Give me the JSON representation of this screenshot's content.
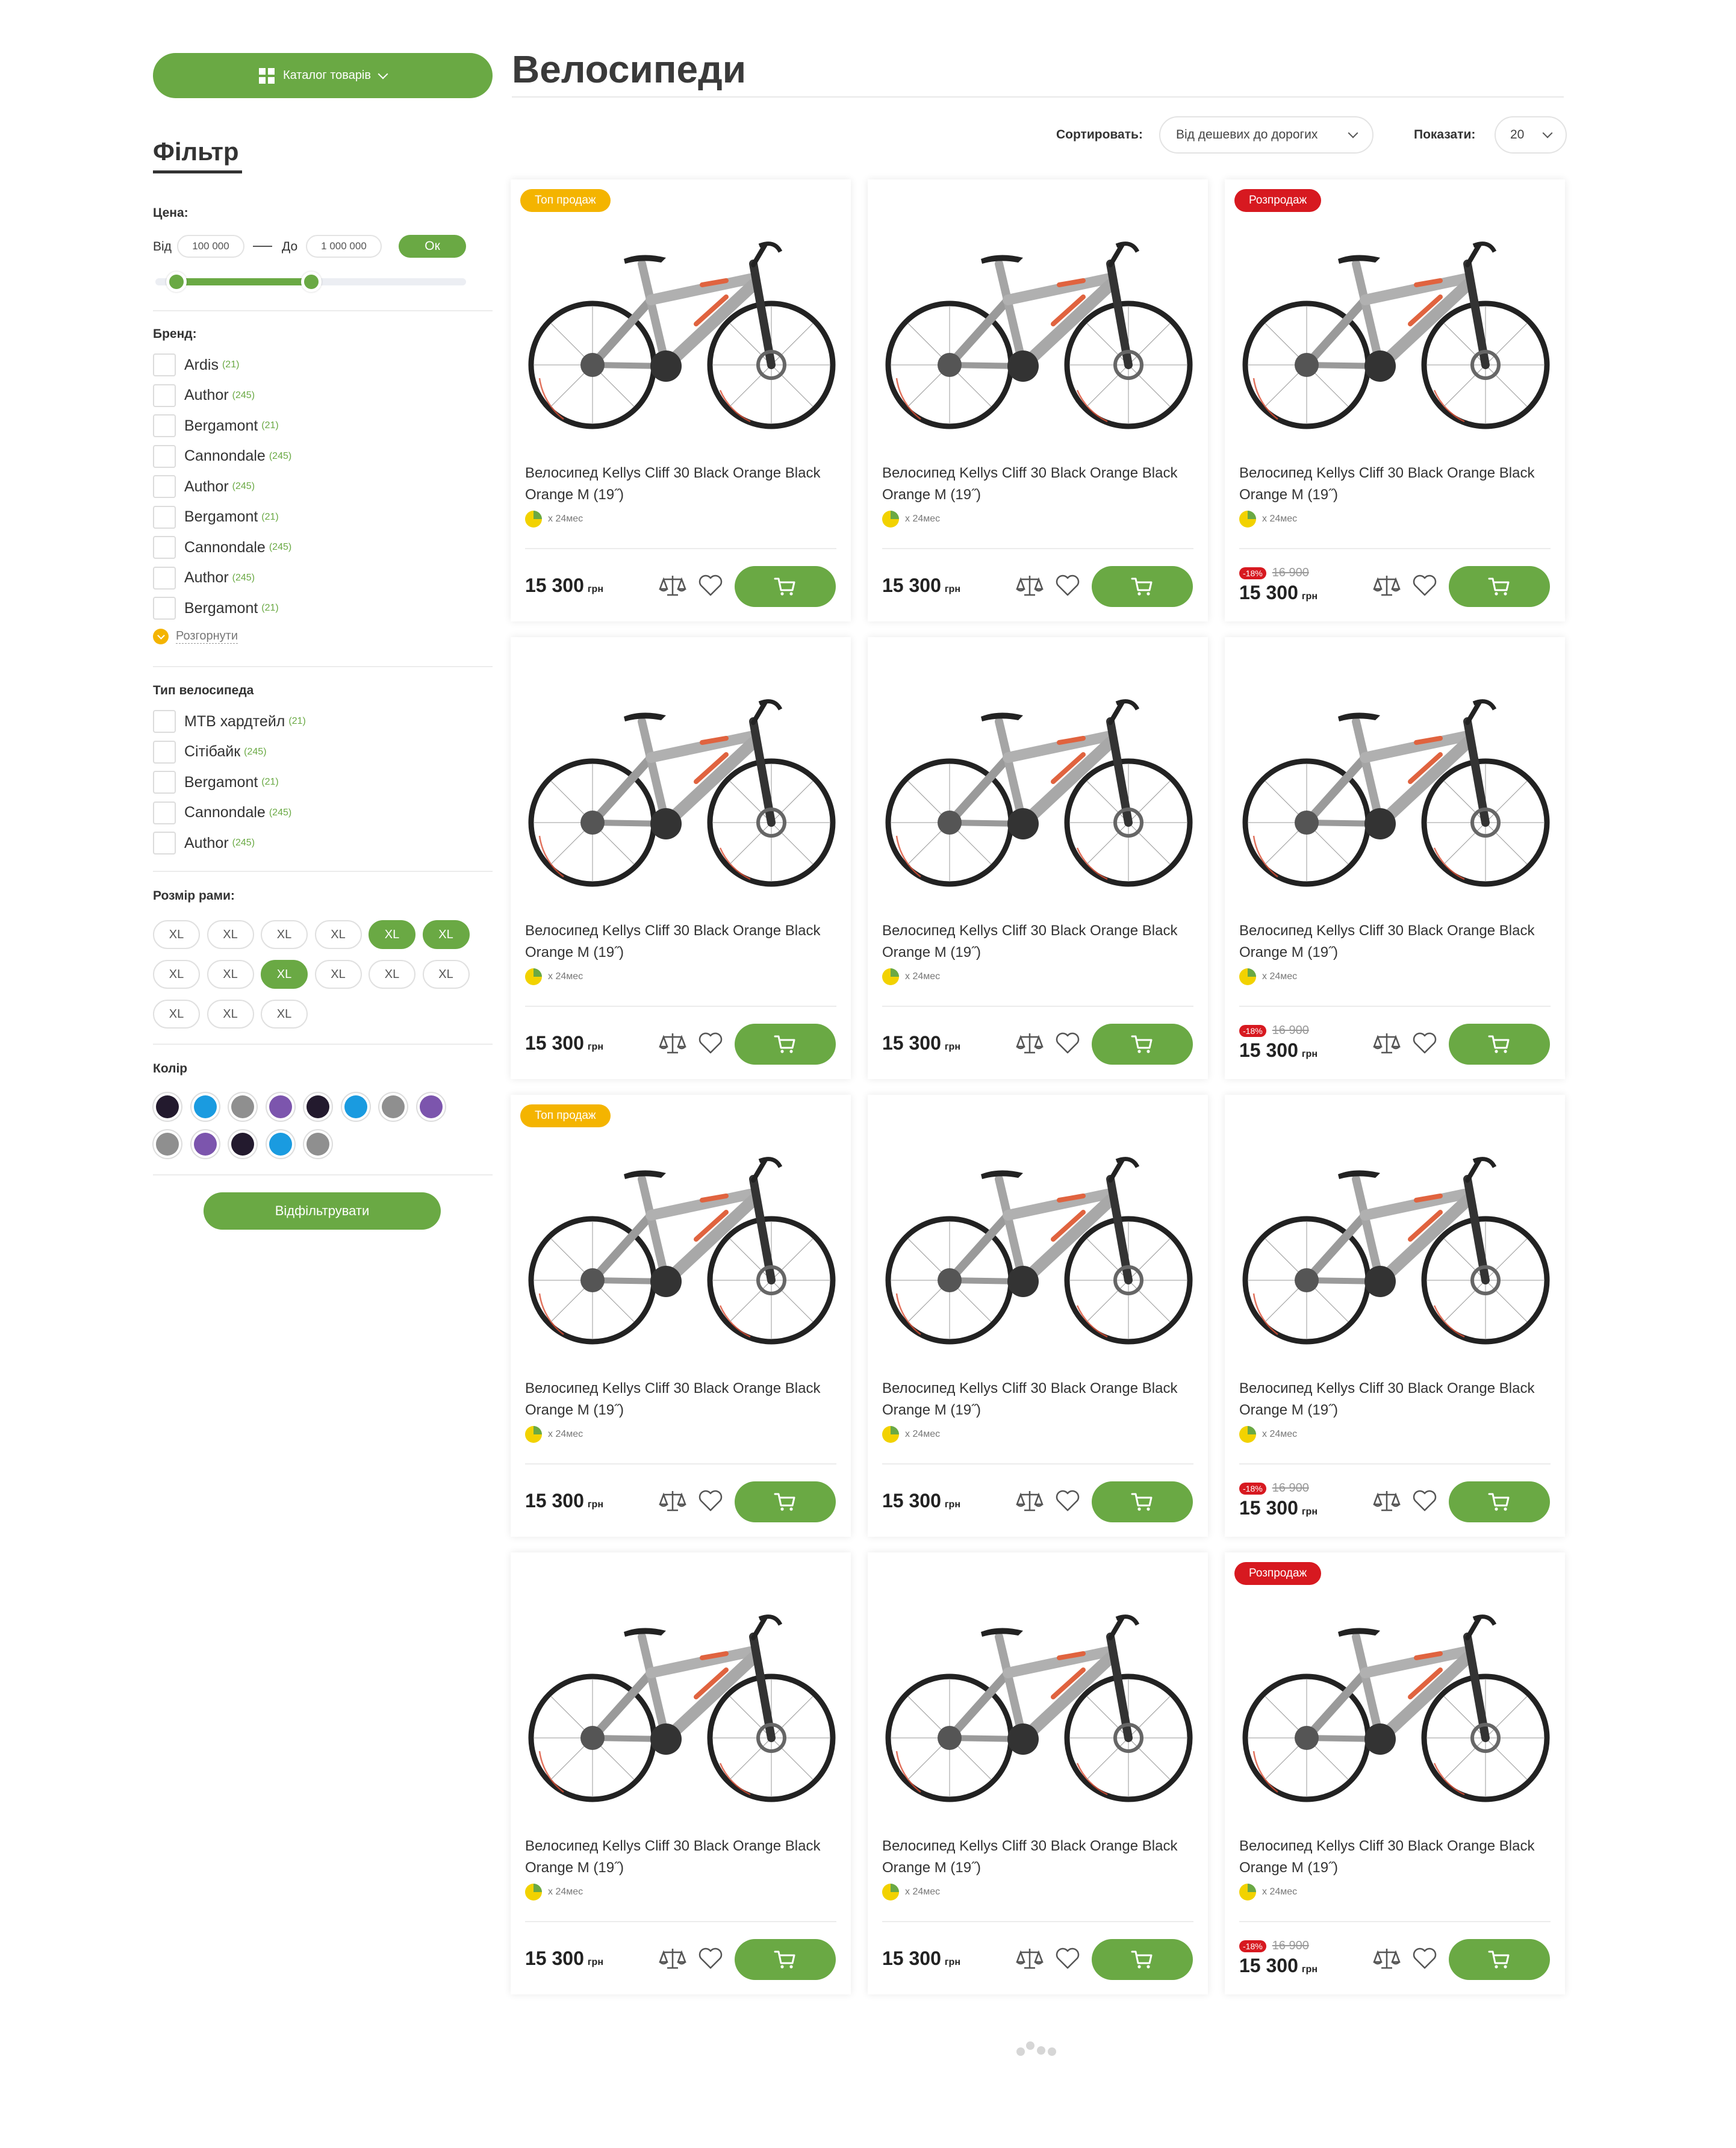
{
  "catalog_button": {
    "label": "Каталог товарів"
  },
  "page_title": "Велосипеди",
  "sort": {
    "label": "Сортировать:",
    "value": "Від дешевих до дорогих",
    "show_label": "Показати:",
    "show_value": "20"
  },
  "filter": {
    "title": "Фільтр",
    "price": {
      "label": "Цена:",
      "from_label": "Від",
      "from_value": "100 000",
      "to_label": "До",
      "to_value": "1 000 000",
      "ok_label": "Ок"
    },
    "brand": {
      "label": "Бренд:",
      "items": [
        {
          "label": "Ardis",
          "count": "(21)"
        },
        {
          "label": "Author",
          "count": "(245)"
        },
        {
          "label": "Bergamont",
          "count": "(21)"
        },
        {
          "label": "Cannondale",
          "count": "(245)"
        },
        {
          "label": "Author",
          "count": "(245)"
        },
        {
          "label": "Bergamont",
          "count": "(21)"
        },
        {
          "label": "Cannondale",
          "count": "(245)"
        },
        {
          "label": "Author",
          "count": "(245)"
        },
        {
          "label": "Bergamont",
          "count": "(21)"
        }
      ],
      "expand_label": "Розгорнути"
    },
    "bike_type": {
      "label": "Тип велосипеда",
      "items": [
        {
          "label": "МТВ хардтейл",
          "count": "(21)"
        },
        {
          "label": "Сітібайк",
          "count": "(245)"
        },
        {
          "label": "Bergamont",
          "count": "(21)"
        },
        {
          "label": "Cannondale",
          "count": "(245)"
        },
        {
          "label": "Author",
          "count": "(245)"
        }
      ]
    },
    "frame_size": {
      "label": "Розмір рами:",
      "items": [
        {
          "label": "XL",
          "active": false
        },
        {
          "label": "XL",
          "active": false
        },
        {
          "label": "XL",
          "active": false
        },
        {
          "label": "XL",
          "active": false
        },
        {
          "label": "XL",
          "active": true
        },
        {
          "label": "XL",
          "active": true
        },
        {
          "label": "XL",
          "active": false
        },
        {
          "label": "XL",
          "active": false
        },
        {
          "label": "XL",
          "active": true
        },
        {
          "label": "XL",
          "active": false
        },
        {
          "label": "XL",
          "active": false
        },
        {
          "label": "XL",
          "active": false
        },
        {
          "label": "XL",
          "active": false
        },
        {
          "label": "XL",
          "active": false
        },
        {
          "label": "XL",
          "active": false
        }
      ]
    },
    "color": {
      "label": "Колір",
      "swatches": [
        "#231a2e",
        "#1a9be0",
        "#8f8f8f",
        "#7c55ad",
        "#231a2e",
        "#1a9be0",
        "#8f8f8f",
        "#7c55ad",
        "#8f8f8f",
        "#7c55ad",
        "#231a2e",
        "#1a9be0",
        "#8f8f8f"
      ]
    },
    "apply_label": "Відфільтрувати"
  },
  "currency": "грн",
  "installment": "x 24мес",
  "products": [
    {
      "badge": "Топ продаж",
      "badge_type": "top",
      "name": "Велосипед Kellys Cliff 30 Black Orange Black Orange M (19˝)",
      "price": "15 300",
      "discount": "",
      "old_price": ""
    },
    {
      "badge": "",
      "badge_type": "",
      "name": "Велосипед Kellys Cliff 30 Black Orange Black Orange M (19˝)",
      "price": "15 300",
      "discount": "",
      "old_price": ""
    },
    {
      "badge": "Розпродаж",
      "badge_type": "sale",
      "name": "Велосипед Kellys Cliff 30 Black Orange Black Orange M (19˝)",
      "price": "15 300",
      "discount": "-18%",
      "old_price": "16 900"
    },
    {
      "badge": "",
      "badge_type": "",
      "name": "Велосипед Kellys Cliff 30 Black Orange Black Orange M (19˝)",
      "price": "15 300",
      "discount": "",
      "old_price": ""
    },
    {
      "badge": "",
      "badge_type": "",
      "name": "Велосипед Kellys Cliff 30 Black Orange Black Orange M (19˝)",
      "price": "15 300",
      "discount": "",
      "old_price": ""
    },
    {
      "badge": "",
      "badge_type": "",
      "name": "Велосипед Kellys Cliff 30 Black Orange Black Orange M (19˝)",
      "price": "15 300",
      "discount": "-18%",
      "old_price": "16 900"
    },
    {
      "badge": "Топ продаж",
      "badge_type": "top",
      "name": "Велосипед Kellys Cliff 30 Black Orange Black Orange M (19˝)",
      "price": "15 300",
      "discount": "",
      "old_price": ""
    },
    {
      "badge": "",
      "badge_type": "",
      "name": "Велосипед Kellys Cliff 30 Black Orange Black Orange M (19˝)",
      "price": "15 300",
      "discount": "",
      "old_price": ""
    },
    {
      "badge": "",
      "badge_type": "",
      "name": "Велосипед Kellys Cliff 30 Black Orange Black Orange M (19˝)",
      "price": "15 300",
      "discount": "-18%",
      "old_price": "16 900"
    },
    {
      "badge": "",
      "badge_type": "",
      "name": "Велосипед Kellys Cliff 30 Black Orange Black Orange M (19˝)",
      "price": "15 300",
      "discount": "",
      "old_price": ""
    },
    {
      "badge": "",
      "badge_type": "",
      "name": "Велосипед Kellys Cliff 30 Black Orange Black Orange M (19˝)",
      "price": "15 300",
      "discount": "",
      "old_price": ""
    },
    {
      "badge": "Розпродаж",
      "badge_type": "sale",
      "name": "Велосипед Kellys Cliff 30 Black Orange Black Orange M (19˝)",
      "price": "15 300",
      "discount": "-18%",
      "old_price": "16 900"
    }
  ],
  "colors": {
    "accent": "#6aa944",
    "top_badge": "#f4b400",
    "sale_badge": "#d71920"
  }
}
